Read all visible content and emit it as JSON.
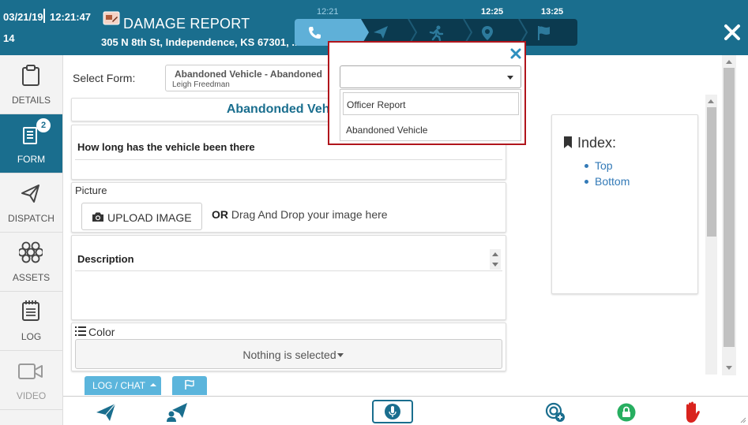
{
  "header": {
    "date": "03/21/19",
    "time": "12:21:47",
    "number": "14",
    "title": "DAMAGE REPORT",
    "address": "305 N 8th St, Independence, KS 67301, ...",
    "close_icon": "close-icon"
  },
  "stepper": {
    "steps": [
      {
        "name": "phone",
        "time": "12:21",
        "active": true
      },
      {
        "name": "dispatch",
        "time": "",
        "active": false
      },
      {
        "name": "enroute",
        "time": "",
        "active": false
      },
      {
        "name": "arrived",
        "time": "12:25",
        "active": false
      },
      {
        "name": "complete",
        "time": "13:25",
        "active": false
      }
    ]
  },
  "sidebar": {
    "items": [
      {
        "label": "DETAILS",
        "icon": "clipboard-icon"
      },
      {
        "label": "FORM",
        "icon": "form-icon",
        "badge": "2"
      },
      {
        "label": "DISPATCH",
        "icon": "paper-plane-icon"
      },
      {
        "label": "ASSETS",
        "icon": "hexagons-icon"
      },
      {
        "label": "LOG",
        "icon": "notebook-icon"
      },
      {
        "label": "VIDEO",
        "icon": "video-camera-icon"
      }
    ]
  },
  "form_selector": {
    "label": "Select Form:",
    "selected_title": "Abandoned Vehicle - Abandoned",
    "selected_sub": "Leigh Freedman"
  },
  "form": {
    "title": "Abandonded Vehicle",
    "question": "How long has the vehicle been there",
    "picture_label": "Picture",
    "upload_label": "UPLOAD IMAGE",
    "or_label": "OR",
    "drag_text": "Drag And Drop your image here",
    "description_label": "Description",
    "color_label": "Color",
    "color_value": "Nothing is selected"
  },
  "index": {
    "title": "Index:",
    "links": [
      "Top",
      "Bottom"
    ]
  },
  "bottom": {
    "log_chat_label": "LOG / CHAT"
  },
  "popup": {
    "select_value": "",
    "options": [
      "Officer Report",
      "Abandoned Vehicle"
    ]
  },
  "colors": {
    "header_bg": "#1a6e8e",
    "accent": "#5fb0d8",
    "stepper_bg": "#0b3a4f",
    "title_blue": "#1a6e8e",
    "popup_border": "#b0151c",
    "green": "#27ae60",
    "red": "#d9231d"
  }
}
